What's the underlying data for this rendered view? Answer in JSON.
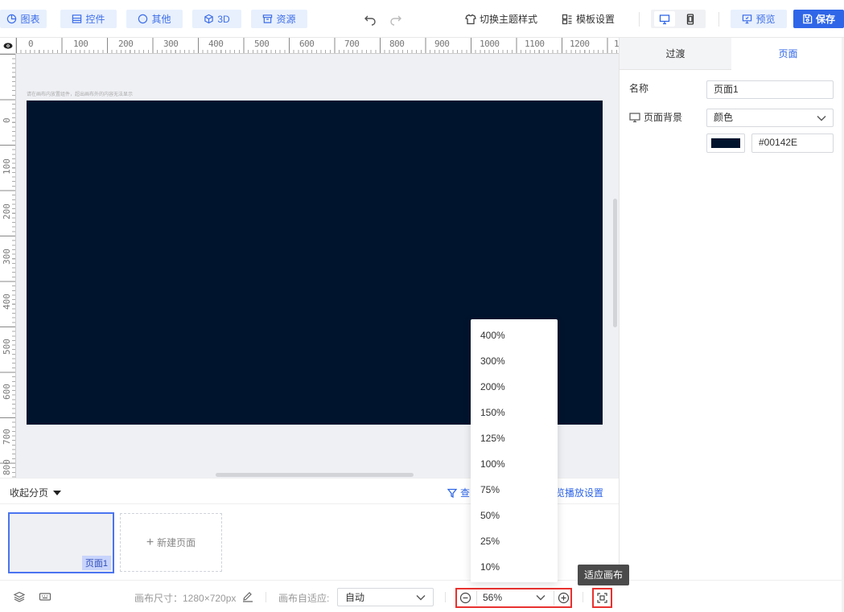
{
  "toolbar": {
    "chart_btn": "图表",
    "widget_btn": "控件",
    "other_btn": "其他",
    "threed_btn": "3D",
    "resource_btn": "资源",
    "theme_btn": "切换主题样式",
    "template_btn": "模板设置",
    "preview_btn": "预览",
    "save_btn": "保存"
  },
  "canvas": {
    "hint": "请在画布内放置组件，超出画布外的内容无法显示",
    "background_color": "#00142E",
    "ruler_top": [
      "0",
      "100",
      "200",
      "300",
      "400",
      "500",
      "600",
      "700",
      "800",
      "900",
      "1000",
      "1100",
      "1200",
      "1"
    ],
    "ruler_left": [
      "0",
      "100",
      "200",
      "300",
      "400",
      "500",
      "600",
      "700",
      "800"
    ]
  },
  "pages": {
    "collapse_label": "收起分页",
    "filter_label": "查",
    "play_settings": "览播放设置",
    "thumb_label": "页面1",
    "new_page": "新建页面"
  },
  "bottom": {
    "canvas_size": "画布尺寸：1280×720px",
    "auto_fit_label": "画布自适应:",
    "auto_fit_value": "自动",
    "zoom_value": "56%",
    "fit_tooltip": "适应画布"
  },
  "zoom_options": [
    "400%",
    "300%",
    "200%",
    "150%",
    "125%",
    "100%",
    "75%",
    "50%",
    "25%",
    "10%"
  ],
  "right_panel": {
    "tab_transition": "过渡",
    "tab_page": "页面",
    "name_label": "名称",
    "name_value": "页面1",
    "bg_label": "页面背景",
    "bg_type": "颜色",
    "bg_color_hex": "#00142E"
  },
  "colors": {
    "accent": "#2f66e8",
    "highlight": "#e8312f"
  }
}
